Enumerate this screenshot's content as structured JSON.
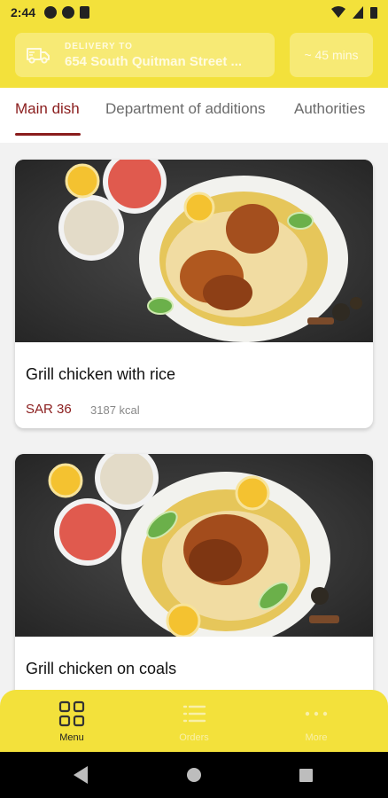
{
  "status_bar": {
    "time": "2:44"
  },
  "delivery": {
    "label": "DELIVERY TO",
    "address": "654 South Quitman Street ...",
    "eta": "~ 45 mins"
  },
  "tabs": [
    {
      "label": "Main dish",
      "active": true
    },
    {
      "label": "Department of additions",
      "active": false
    },
    {
      "label": "Authorities",
      "active": false
    }
  ],
  "menu_items": [
    {
      "name": "Grill chicken with rice",
      "price": "SAR 36",
      "kcal": "3187 kcal"
    },
    {
      "name": "Grill chicken on coals"
    }
  ],
  "bottom_nav": [
    {
      "label": "Menu",
      "icon": "grid-icon",
      "active": true
    },
    {
      "label": "Orders",
      "icon": "list-icon",
      "active": false
    },
    {
      "label": "More",
      "icon": "more-dots-icon",
      "active": false
    }
  ],
  "colors": {
    "brand_yellow": "#f3e13b",
    "accent_red": "#8a1c1c"
  }
}
